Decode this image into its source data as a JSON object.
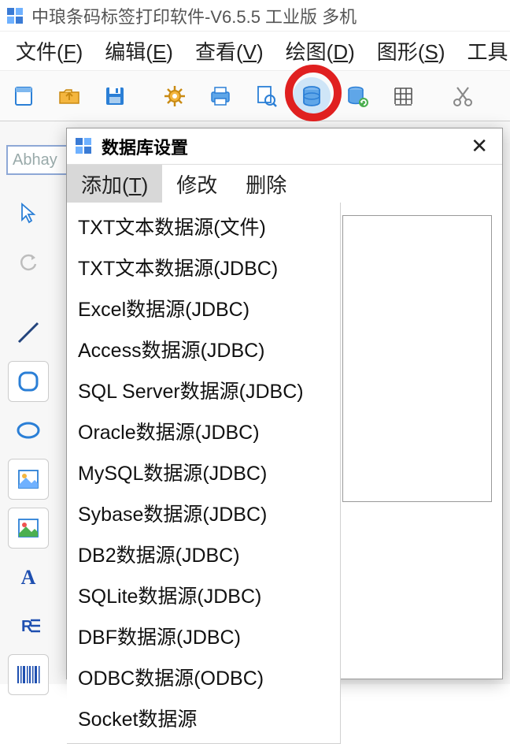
{
  "titlebar": {
    "title": "中琅条码标签打印软件-V6.5.5 工业版 多机"
  },
  "menubar": {
    "items": [
      {
        "label": "文件",
        "key": "F"
      },
      {
        "label": "编辑",
        "key": "E"
      },
      {
        "label": "查看",
        "key": "V"
      },
      {
        "label": "绘图",
        "key": "D"
      },
      {
        "label": "图形",
        "key": "S"
      },
      {
        "label": "工具",
        "key": ""
      }
    ]
  },
  "toolbar": {
    "icons": [
      "new-doc",
      "open-folder",
      "save",
      "",
      "settings-gear",
      "print",
      "print-preview",
      "database",
      "database-refresh",
      "grid",
      "",
      "cut"
    ]
  },
  "document": {
    "tab_label": "Abhay"
  },
  "sidebar": {
    "icons": [
      "cursor",
      "rotate",
      "",
      "line",
      "rounded-rect",
      "ellipse",
      "image",
      "image-color",
      "text-A",
      "text-R",
      "barcode"
    ]
  },
  "dialog": {
    "title": "数据库设置",
    "close_label": "✕",
    "menu": {
      "items": [
        {
          "label": "添加",
          "key": "T"
        },
        {
          "label": "修改",
          "key": ""
        },
        {
          "label": "删除",
          "key": ""
        }
      ]
    },
    "dropdown": {
      "items": [
        "TXT文本数据源(文件)",
        "TXT文本数据源(JDBC)",
        "Excel数据源(JDBC)",
        "Access数据源(JDBC)",
        "SQL Server数据源(JDBC)",
        "Oracle数据源(JDBC)",
        "MySQL数据源(JDBC)",
        "Sybase数据源(JDBC)",
        "DB2数据源(JDBC)",
        "SQLite数据源(JDBC)",
        "DBF数据源(JDBC)",
        "ODBC数据源(ODBC)",
        "Socket数据源"
      ]
    }
  }
}
